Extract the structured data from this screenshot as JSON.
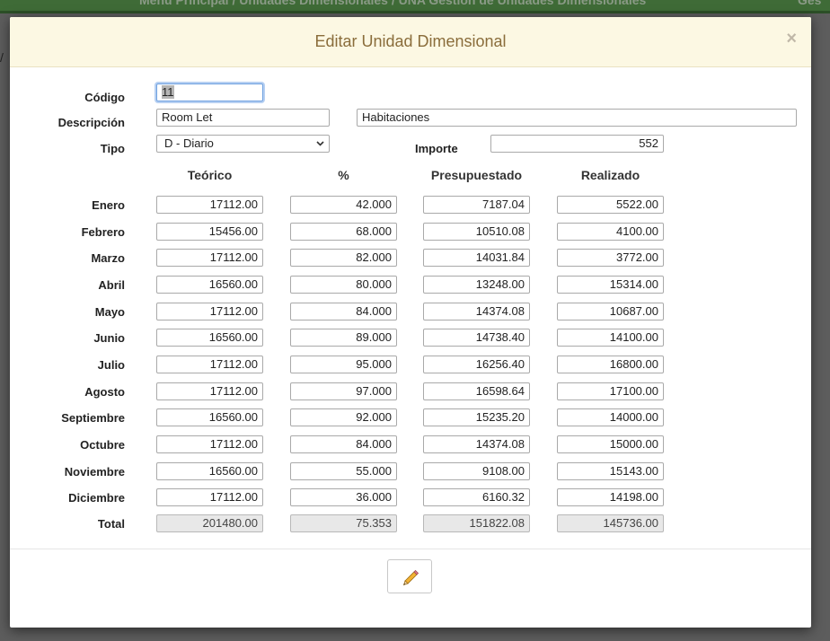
{
  "background": {
    "breadcrumb": "Menú Principal / Unidades Dimensionales / UNA Gestión de Unidades Dimensionales",
    "right_text": "Ges"
  },
  "modal": {
    "title": "Editar Unidad Dimensional",
    "close_label": "×"
  },
  "form": {
    "codigo_label": "Código",
    "codigo_value": "11",
    "descripcion_label": "Descripción",
    "descripcion_value": "Room Let",
    "descripcion2_value": "Habitaciones",
    "tipo_label": "Tipo",
    "tipo_value": "D - Diario",
    "importe_label": "Importe",
    "importe_value": "552"
  },
  "table": {
    "headers": [
      "Teórico",
      "%",
      "Presupuestado",
      "Realizado"
    ],
    "rows": [
      {
        "month": "Enero",
        "teorico": "17112.00",
        "pct": "42.000",
        "presupuestado": "7187.04",
        "realizado": "5522.00"
      },
      {
        "month": "Febrero",
        "teorico": "15456.00",
        "pct": "68.000",
        "presupuestado": "10510.08",
        "realizado": "4100.00"
      },
      {
        "month": "Marzo",
        "teorico": "17112.00",
        "pct": "82.000",
        "presupuestado": "14031.84",
        "realizado": "3772.00"
      },
      {
        "month": "Abril",
        "teorico": "16560.00",
        "pct": "80.000",
        "presupuestado": "13248.00",
        "realizado": "15314.00"
      },
      {
        "month": "Mayo",
        "teorico": "17112.00",
        "pct": "84.000",
        "presupuestado": "14374.08",
        "realizado": "10687.00"
      },
      {
        "month": "Junio",
        "teorico": "16560.00",
        "pct": "89.000",
        "presupuestado": "14738.40",
        "realizado": "14100.00"
      },
      {
        "month": "Julio",
        "teorico": "17112.00",
        "pct": "95.000",
        "presupuestado": "16256.40",
        "realizado": "16800.00"
      },
      {
        "month": "Agosto",
        "teorico": "17112.00",
        "pct": "97.000",
        "presupuestado": "16598.64",
        "realizado": "17100.00"
      },
      {
        "month": "Septiembre",
        "teorico": "16560.00",
        "pct": "92.000",
        "presupuestado": "15235.20",
        "realizado": "14000.00"
      },
      {
        "month": "Octubre",
        "teorico": "17112.00",
        "pct": "84.000",
        "presupuestado": "14374.08",
        "realizado": "15000.00"
      },
      {
        "month": "Noviembre",
        "teorico": "16560.00",
        "pct": "55.000",
        "presupuestado": "9108.00",
        "realizado": "15143.00"
      },
      {
        "month": "Diciembre",
        "teorico": "17112.00",
        "pct": "36.000",
        "presupuestado": "6160.32",
        "realizado": "14198.00"
      }
    ],
    "total": {
      "label": "Total",
      "teorico": "201480.00",
      "pct": "75.353",
      "presupuestado": "151822.08",
      "realizado": "145736.00"
    }
  },
  "footer": {
    "edit_icon": "pencil-icon"
  }
}
